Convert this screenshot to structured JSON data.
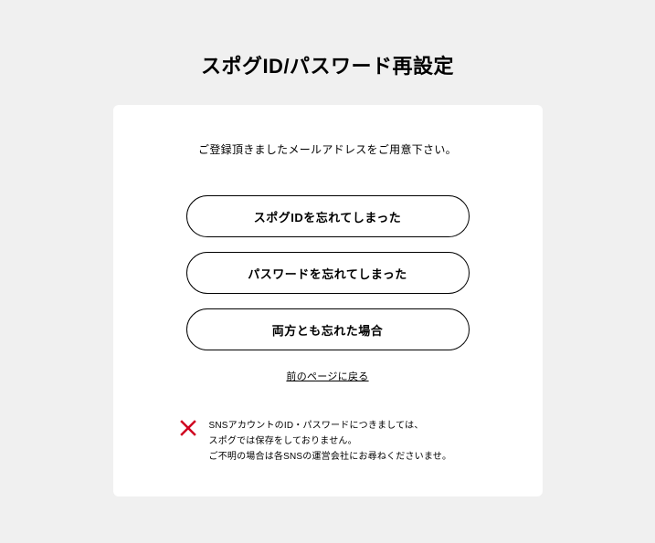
{
  "header": {
    "title": "スポグID/パスワード再設定"
  },
  "card": {
    "instruction": "ご登録頂きましたメールアドレスをご用意下さい。",
    "buttons": {
      "forgot_id": "スポグIDを忘れてしまった",
      "forgot_password": "パスワードを忘れてしまった",
      "forgot_both": "両方とも忘れた場合"
    },
    "back_link": "前のページに戻る",
    "notice": {
      "line1": "SNSアカウントのID・パスワードにつきましては、",
      "line2": "スポグでは保存をしておりません。",
      "line3": "ご不明の場合は各SNSの運営会社にお尋ねくださいませ。"
    }
  }
}
